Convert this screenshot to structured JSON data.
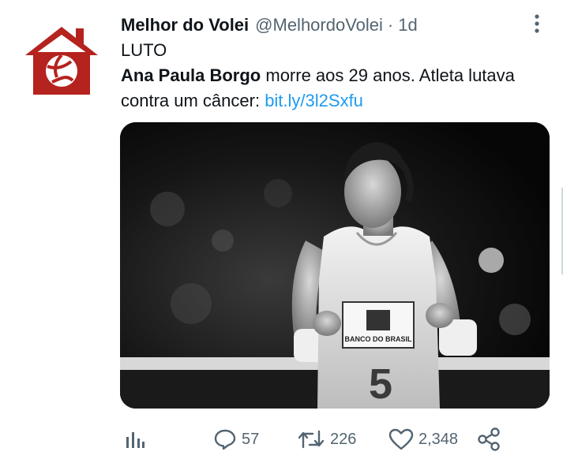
{
  "tweet": {
    "display_name": "Melhor do Volei",
    "handle": "@MelhordoVolei",
    "separator": "·",
    "time": "1d",
    "text_line1": "LUTO",
    "text_bold": "Ana Paula Borgo",
    "text_rest": " morre aos 29 anos. Atleta lutava contra um câncer: ",
    "link": "bit.ly/3l2Sxfu"
  },
  "actions": {
    "replies": "57",
    "retweets": "226",
    "likes": "2,348"
  },
  "icons": {
    "avatar": "house-volleyball-logo",
    "more": "more-vertical-icon",
    "analytics": "analytics-icon",
    "reply": "reply-icon",
    "retweet": "retweet-icon",
    "like": "heart-icon",
    "share": "share-icon"
  },
  "colors": {
    "brand_red": "#b5231f",
    "link": "#1d9bf0",
    "muted": "#536471"
  }
}
